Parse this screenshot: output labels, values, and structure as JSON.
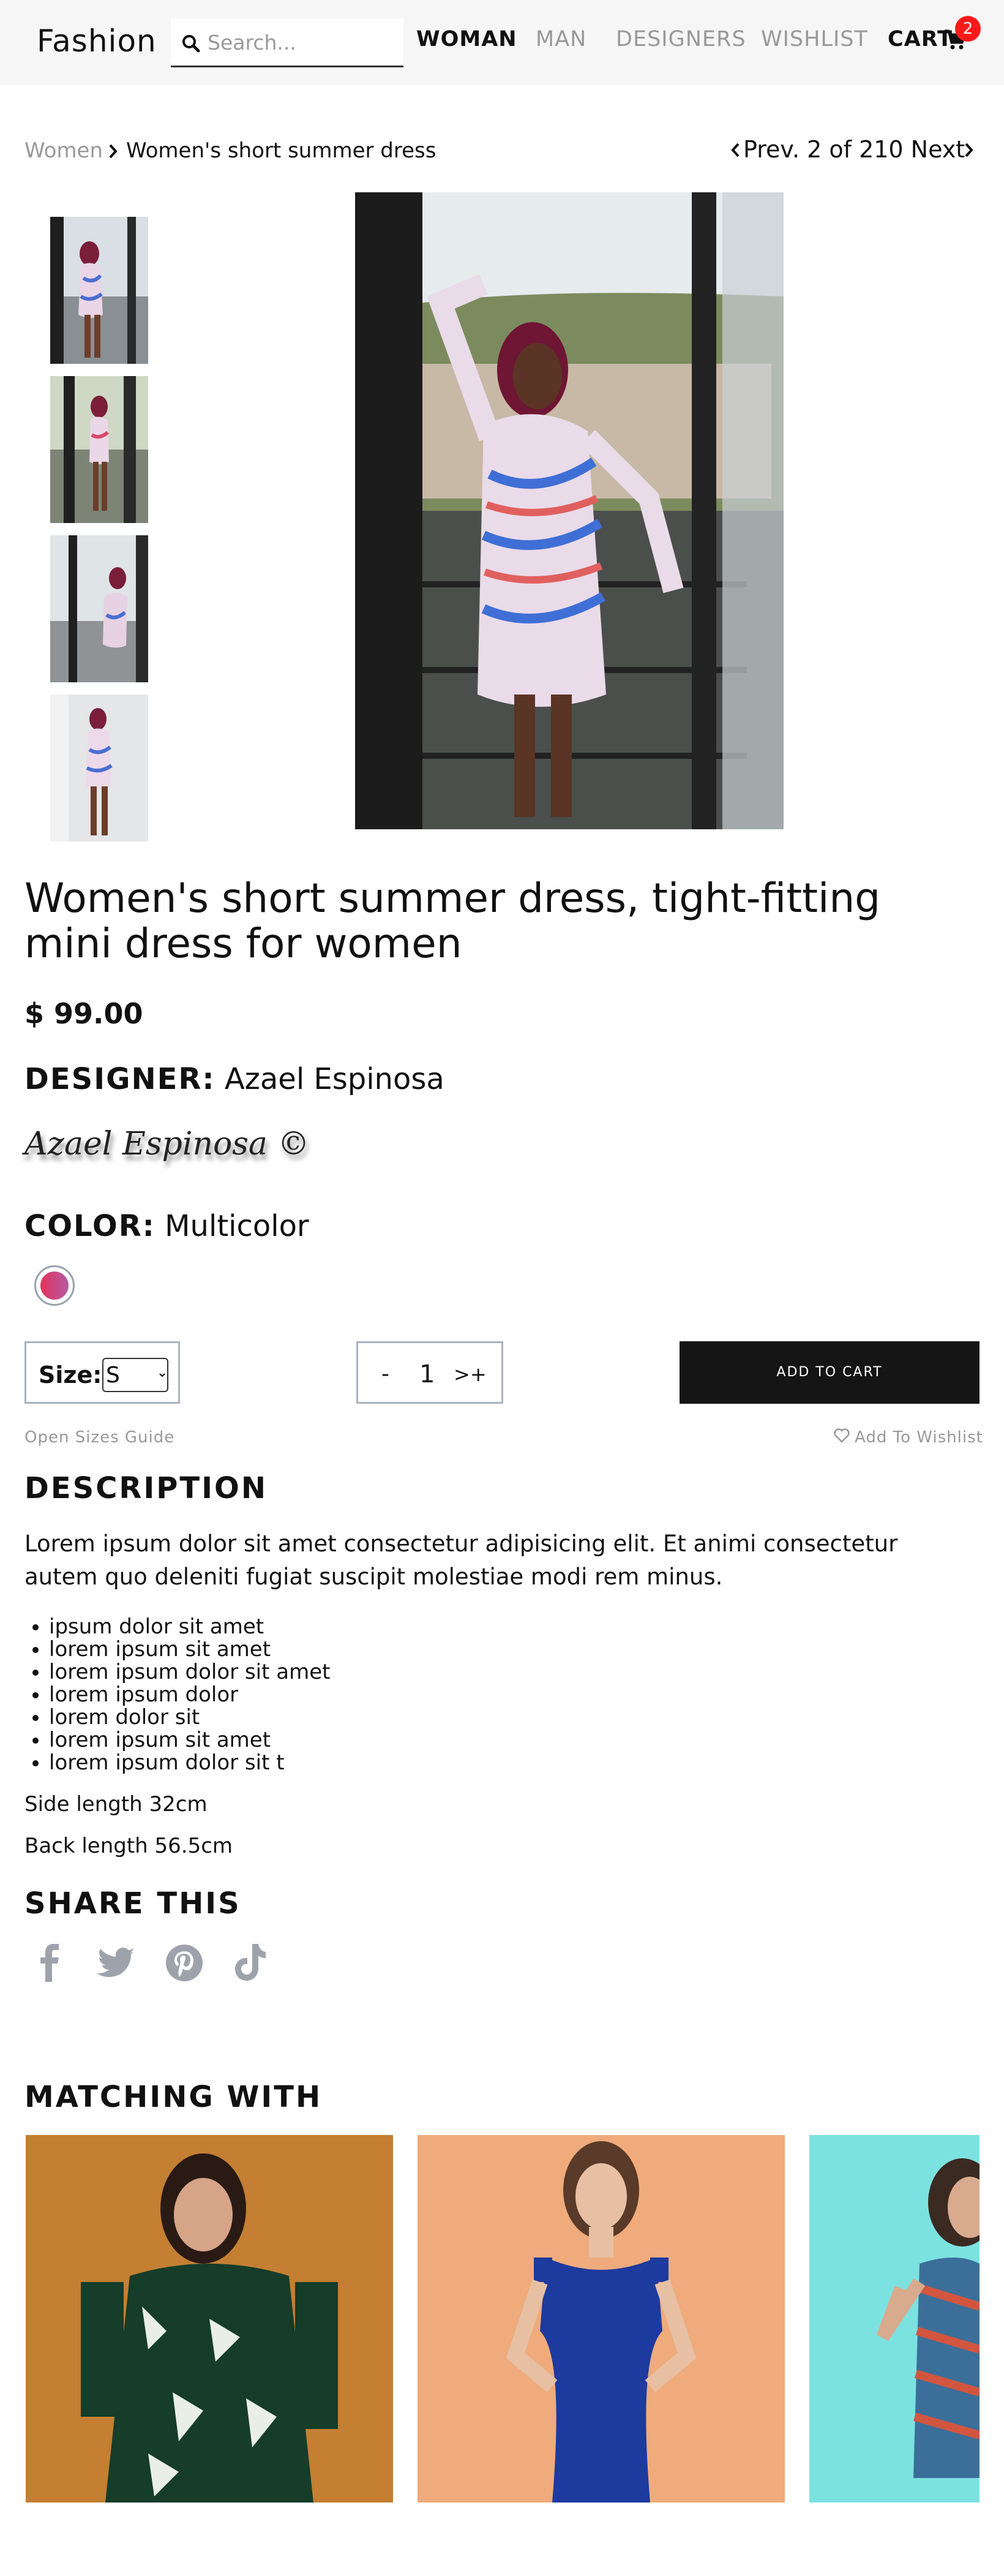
{
  "header": {
    "logo": "Fashion",
    "search_placeholder": "Search...",
    "nav": [
      "WOMAN",
      "MAN",
      "DESIGNERS",
      "WISHLIST"
    ],
    "cart_label": "CART",
    "cart_count": "2"
  },
  "breadcrumb": {
    "parent": "Women",
    "current": "Women's short summer dress",
    "pager": "Prev. 2 of 210 Next"
  },
  "product": {
    "title": "Women's short summer dress, tight-fitting mini dress for women",
    "price": "$ 99.00",
    "designer_label": "DESIGNER:",
    "designer": "Azael Espinosa",
    "signature": "Azael Espinosa ©",
    "color_label": "COLOR:",
    "color": "Multicolor",
    "size_label": "Size:",
    "size_selected": "S",
    "qty_minus": "-",
    "qty_value": "1",
    "qty_plus": ">+",
    "add_to_cart": "ADD TO CART",
    "sizes_guide": "Open Sizes Guide",
    "wishlist": "Add To Wishlist"
  },
  "description": {
    "heading": "DESCRIPTION",
    "text": "Lorem ipsum dolor sit amet consectetur adipisicing elit. Et animi consectetur autem quo deleniti fugiat suscipit molestiae modi rem minus.",
    "features": [
      "ipsum dolor sit amet",
      "lorem ipsum sit amet",
      "lorem ipsum dolor sit amet",
      "lorem ipsum dolor",
      "lorem dolor sit",
      "lorem ipsum sit amet",
      "lorem ipsum dolor sit t"
    ],
    "side_length": "Side length 32cm",
    "back_length": "Back length 56.5cm"
  },
  "share": {
    "heading": "SHARE THIS",
    "icons": [
      "facebook-icon",
      "twitter-icon",
      "pinterest-icon",
      "tiktok-icon"
    ]
  },
  "matching": {
    "heading": "MATCHING WITH"
  },
  "colors": {
    "accent": "#151515",
    "badge": "#ff1a1a",
    "muted": "#999999",
    "icon_gray": "#9ea3ab"
  }
}
